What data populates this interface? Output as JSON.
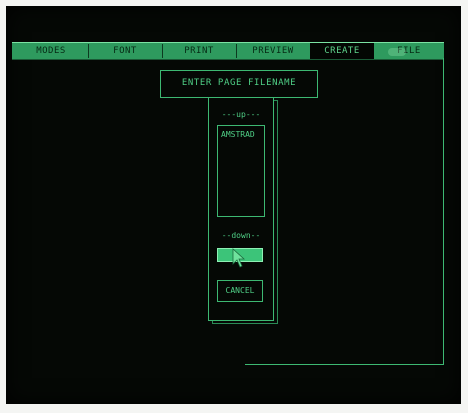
{
  "menubar": {
    "items": [
      {
        "label": "MODES",
        "active": false
      },
      {
        "label": "FONT",
        "active": false
      },
      {
        "label": "PRINT",
        "active": false
      },
      {
        "label": "PREVIEW",
        "active": false
      },
      {
        "label": "CREATE",
        "active": true
      },
      {
        "label": "FILE",
        "active": false
      }
    ]
  },
  "dialog": {
    "title": "ENTER PAGE FILENAME",
    "up_label": "---up---",
    "down_label": "--down--",
    "files": [
      "AMSTRAD"
    ],
    "ok_label": "",
    "cancel_label": "CANCEL"
  },
  "colors": {
    "phosphor_green": "#4fcf86",
    "menubar_green": "#2e9a5e",
    "screen_background": "#050805"
  },
  "icons": {
    "cursor": "arrow-pointer-icon"
  }
}
